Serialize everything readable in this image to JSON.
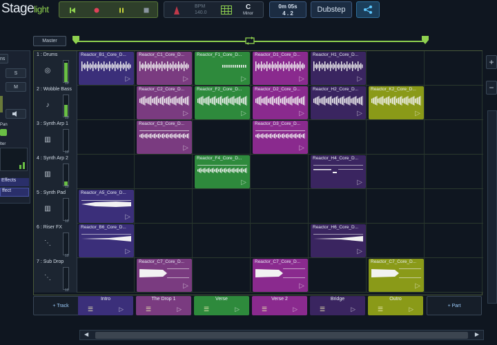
{
  "app": {
    "logo_main": "Stage",
    "logo_accent": "light"
  },
  "transport": {
    "buttons": [
      "skip-back",
      "record",
      "pause",
      "stop"
    ]
  },
  "tempo": {
    "bpm_label": "BPM",
    "bpm_value": "140.0",
    "key": "C",
    "mode": "Minor"
  },
  "position": {
    "time": "0m 05s",
    "bars": "4 . 2"
  },
  "genre": "Dubstep",
  "left_panel": {
    "labels": [
      "ns",
      "S",
      "M",
      "Pan",
      "lter",
      "Effects",
      "ffect"
    ]
  },
  "master_label": "Master",
  "zoom": {
    "in": "+",
    "out": "−"
  },
  "tracks": [
    {
      "name": "1 : Drums",
      "icon": "drums-icon",
      "level": 10,
      "meter_fill": 0.9
    },
    {
      "name": "2 : Wobble Bass",
      "icon": "bass-icon",
      "level": 10,
      "meter_fill": 0.55
    },
    {
      "name": "3 : Synth Arp 1",
      "icon": "keyboard-icon",
      "level": 10,
      "meter_fill": 0.0
    },
    {
      "name": "4 : Synth Arp 2",
      "icon": "keyboard-icon",
      "level": 10,
      "meter_fill": 0.2
    },
    {
      "name": "5 : Synth Pad",
      "icon": "keyboard-icon",
      "level": 10,
      "meter_fill": 0.0
    },
    {
      "name": "6 : Riser FX",
      "icon": "fx-icon",
      "level": 10,
      "meter_fill": 0.0
    },
    {
      "name": "7 : Sub Drop",
      "icon": "fx-icon",
      "level": 10,
      "meter_fill": 0.0
    }
  ],
  "clips": [
    {
      "track": 0,
      "col": 0,
      "title": "Reactor_B1_Core_D...",
      "color": "#3b2f7a",
      "style": "drum"
    },
    {
      "track": 0,
      "col": 1,
      "title": "Reactor_C1_Core_D...",
      "color": "#7a3b80",
      "style": "drum"
    },
    {
      "track": 0,
      "col": 2,
      "title": "Reactor_F1_Core_D...",
      "color": "#2e8a3c",
      "style": "drumlite"
    },
    {
      "track": 0,
      "col": 3,
      "title": "Reactor_D1_Core_D...",
      "color": "#8a2a8e",
      "style": "drum"
    },
    {
      "track": 0,
      "col": 4,
      "title": "Reactor_H1_Core_D...",
      "color": "#3a2560",
      "style": "drum"
    },
    {
      "track": 1,
      "col": 1,
      "title": "Reactor_C2_Core_D...",
      "color": "#7a3b80",
      "style": "dense"
    },
    {
      "track": 1,
      "col": 2,
      "title": "Reactor_F2_Core_D...",
      "color": "#2e8a3c",
      "style": "dense"
    },
    {
      "track": 1,
      "col": 3,
      "title": "Reactor_D2_Core_D...",
      "color": "#8a2a8e",
      "style": "dense"
    },
    {
      "track": 1,
      "col": 4,
      "title": "Reactor_H2_Core_D...",
      "color": "#3a2560",
      "style": "dense"
    },
    {
      "track": 1,
      "col": 5,
      "title": "Reactor_K2_Core_D...",
      "color": "#8a9a18",
      "style": "dense"
    },
    {
      "track": 2,
      "col": 1,
      "title": "Reactor_C3_Core_D...",
      "color": "#7a3b80",
      "style": "arp"
    },
    {
      "track": 2,
      "col": 3,
      "title": "Reactor_D3_Core_D...",
      "color": "#8a2a8e",
      "style": "arp"
    },
    {
      "track": 3,
      "col": 2,
      "title": "Reactor_F4_Core_D...",
      "color": "#2e8a3c",
      "style": "arp"
    },
    {
      "track": 3,
      "col": 4,
      "title": "Reactor_H4_Core_D...",
      "color": "#3a2560",
      "style": "sparse"
    },
    {
      "track": 4,
      "col": 0,
      "title": "Reactor_A5_Core_D...",
      "color": "#3b2f7a",
      "style": "pad"
    },
    {
      "track": 5,
      "col": 0,
      "title": "Reactor_B6_Core_D...",
      "color": "#3b2f7a",
      "style": "riser"
    },
    {
      "track": 5,
      "col": 4,
      "title": "Reactor_H6_Core_D...",
      "color": "#3a2560",
      "style": "riser"
    },
    {
      "track": 6,
      "col": 1,
      "title": "Reactor_C7_Core_D...",
      "color": "#7a3b80",
      "style": "sub"
    },
    {
      "track": 6,
      "col": 3,
      "title": "Reactor_C7_Core_D...",
      "color": "#8a2a8e",
      "style": "sub"
    },
    {
      "track": 6,
      "col": 5,
      "title": "Reactor_C7_Core_D...",
      "color": "#8a9a18",
      "style": "sub"
    }
  ],
  "parts": [
    {
      "label": "Intro",
      "color": "#3b2f7a"
    },
    {
      "label": "The Drop 1",
      "color": "#7a3b80"
    },
    {
      "label": "Verse",
      "color": "#2e8a3c"
    },
    {
      "label": "Verse 2",
      "color": "#8a2a8e"
    },
    {
      "label": "Bridge",
      "color": "#3a2560"
    },
    {
      "label": "Outro",
      "color": "#8a9a18"
    }
  ],
  "add_track_label": "+ Track",
  "add_part_label": "+ Part",
  "scroll": {
    "left": "◀",
    "right": "▶"
  }
}
